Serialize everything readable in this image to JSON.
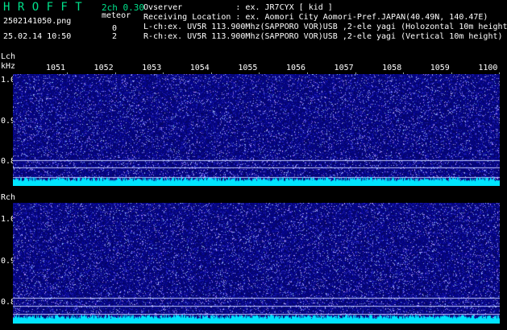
{
  "app": {
    "title": "H R O F F T",
    "version": "2ch 0.30",
    "filename": "2502141050.png",
    "meteor_label": "meteor",
    "lch_count": "0",
    "rch_count": "2",
    "datetime": "25.02.14 10:50"
  },
  "info": {
    "observer": "Ovserver           : ex. JR7CYX [ kid ]",
    "location": "Receiving Location : ex. Aomori City Aomori-Pref.JAPAN(40.49N, 140.47E)",
    "lch": "L-ch:ex. UV5R 113.900Mhz(SAPPORO VOR)USB ,2-ele yagi (Holozontal 10m height)",
    "rch": "R-ch:ex. UV5R 113.900Mhz(SAPPORO VOR)USB ,2-ele yagi (Vertical 10m height)"
  },
  "lch_panel": {
    "label": "Lch",
    "unit": "kHz",
    "yticks": [
      "1.0",
      "0.9",
      "0.8"
    ]
  },
  "rch_panel": {
    "label": "Rch",
    "yticks": [
      "1.0",
      "0.9",
      "0.8"
    ]
  },
  "time_axis": [
    "1051",
    "1052",
    "1053",
    "1054",
    "1055",
    "1056",
    "1057",
    "1058",
    "1059",
    "1100"
  ],
  "colors": {
    "background": "#000000",
    "waterfall": "#0a0a80",
    "noise_floor": "#00e5ff",
    "title": "#00e08a",
    "grid_line": "#c0c8ff"
  }
}
